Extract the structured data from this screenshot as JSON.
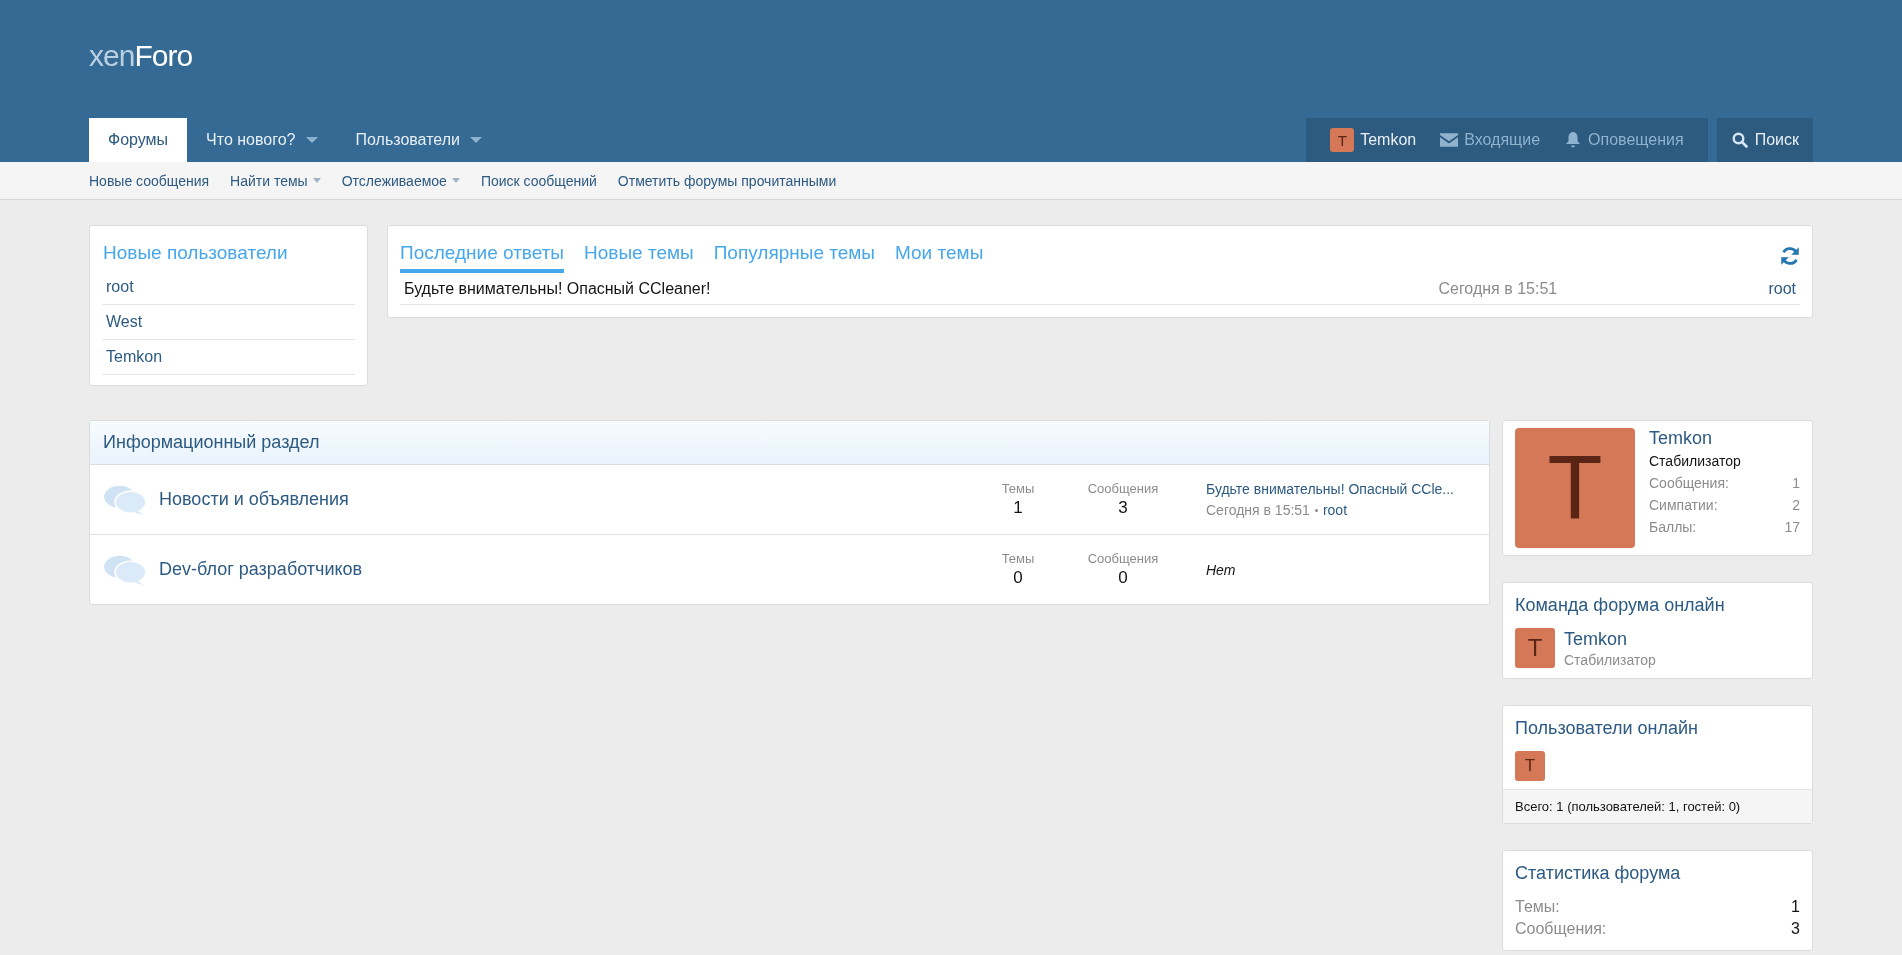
{
  "logo": "xen**Foro**",
  "nav_tabs": [
    {
      "label": "Форумы",
      "selected": true,
      "has_menu": false
    },
    {
      "label": "Что нового?",
      "selected": false,
      "has_menu": true
    },
    {
      "label": "Пользователи",
      "selected": false,
      "has_menu": true
    }
  ],
  "user_nav": [
    {
      "kind": "user",
      "avatar": "T",
      "label": "Temkon"
    },
    {
      "kind": "inbox",
      "label": "Входящие"
    },
    {
      "kind": "alerts",
      "label": "Оповещения"
    }
  ],
  "search_button": "Поиск",
  "sub_nav": [
    {
      "label": "Новые сообщения",
      "has_menu": false
    },
    {
      "label": "Найти темы",
      "has_menu": true
    },
    {
      "label": "Отслеживаемое",
      "has_menu": true
    },
    {
      "label": "Поиск сообщений",
      "has_menu": false
    },
    {
      "label": "Отметить форумы прочитанными",
      "has_menu": false
    }
  ],
  "new_members": {
    "title": "Новые пользователи",
    "items": [
      "root",
      "West",
      "Temkon"
    ]
  },
  "recent": {
    "tabs": [
      {
        "label": "Последние ответы",
        "selected": true
      },
      {
        "label": "Новые темы",
        "selected": false
      },
      {
        "label": "Популярные темы",
        "selected": false
      },
      {
        "label": "Мои темы",
        "selected": false
      }
    ],
    "rows": [
      {
        "title": "Будьте внимательны! Опасный CCleaner!",
        "time": "Сегодня в 15:51",
        "user": "root"
      }
    ]
  },
  "category": {
    "title": "Информационный раздел",
    "nodes": [
      {
        "title": "Новости и объявления",
        "threads_label": "Темы",
        "threads": "1",
        "posts_label": "Сообщения",
        "posts": "3",
        "last": {
          "kind": "post",
          "title": "Будьте внимательны! Опасный CCle...",
          "time": "Сегодня в 15:51",
          "user": "root"
        }
      },
      {
        "title": "Dev-блог разработчиков",
        "threads_label": "Темы",
        "threads": "0",
        "posts_label": "Сообщения",
        "posts": "0",
        "last": {
          "kind": "none",
          "text": "Нет"
        }
      }
    ]
  },
  "profile": {
    "avatar": "T",
    "name": "Temkon",
    "title": "Стабилизатор",
    "stats": [
      {
        "label": "Сообщения:",
        "value": "1"
      },
      {
        "label": "Симпатии:",
        "value": "2"
      },
      {
        "label": "Баллы:",
        "value": "17"
      }
    ]
  },
  "staff_online": {
    "title": "Команда форума онлайн",
    "members": [
      {
        "avatar": "T",
        "name": "Temkon",
        "title": "Стабилизатор"
      }
    ]
  },
  "users_online": {
    "title": "Пользователи онлайн",
    "avatars": [
      "T"
    ],
    "footer": "Всего: 1 (пользователей: 1, гостей: 0)"
  },
  "forum_stats": {
    "title": "Статистика форума",
    "rows": [
      {
        "label": "Темы:",
        "value": "1"
      },
      {
        "label": "Сообщения:",
        "value": "3"
      }
    ]
  }
}
